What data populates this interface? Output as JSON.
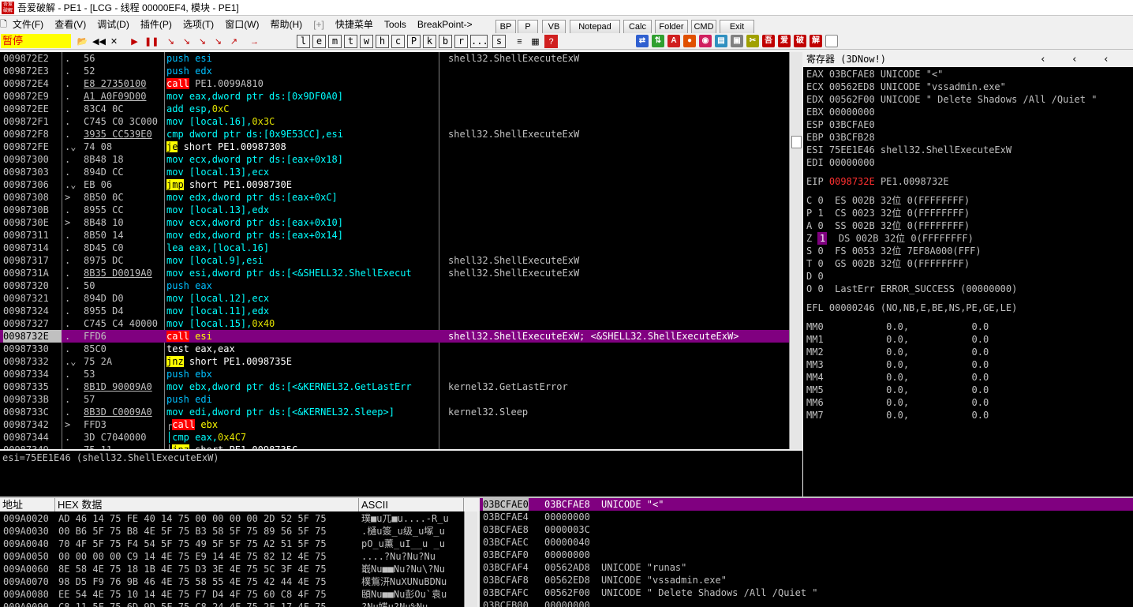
{
  "window": {
    "title": "吾爱破解 - PE1 - [LCG - 线程 00000EF4, 模块 - PE1]",
    "logo_text": "吾爱破解"
  },
  "menu": [
    "文件(F)",
    "查看(V)",
    "调试(D)",
    "插件(P)",
    "选项(T)",
    "窗口(W)",
    "帮助(H)",
    "[+]",
    "快捷菜单",
    "Tools",
    "BreakPoint->"
  ],
  "cmd_buttons": [
    "BP",
    "P",
    "VB",
    "Notepad",
    "Calc",
    "Folder",
    "CMD",
    "Exit"
  ],
  "toolbar": {
    "status": "暂停",
    "nav": [
      "◀◀",
      "✕",
      "▶",
      "❚❚",
      "↘",
      "↘",
      "↘",
      "↘",
      "↗",
      "→"
    ],
    "letters": [
      "l",
      "e",
      "m",
      "t",
      "w",
      "h",
      "c",
      "P",
      "k",
      "b",
      "r",
      "...",
      "s"
    ],
    "extra": [
      "≡",
      "▦",
      "?"
    ],
    "icons": [
      {
        "t": "⇄",
        "c": "#3060d0"
      },
      {
        "t": "⇅",
        "c": "#30a030"
      },
      {
        "t": "A",
        "c": "#d02020"
      },
      {
        "t": "●",
        "c": "#e05000"
      },
      {
        "t": "◉",
        "c": "#d02060"
      },
      {
        "t": "▤",
        "c": "#3090c0"
      },
      {
        "t": "▣",
        "c": "#808080"
      },
      {
        "t": "✂",
        "c": "#a0a000"
      },
      {
        "t": "吾",
        "c": "#c00000"
      },
      {
        "t": "爱",
        "c": "#c00000"
      },
      {
        "t": "破",
        "c": "#c00000"
      },
      {
        "t": "解",
        "c": "#c00000"
      },
      {
        "t": "",
        "c": "#ffffff"
      }
    ]
  },
  "disasm": [
    {
      "addr": "009872E2",
      "mark": ".",
      "hex": "56",
      "asm": [
        {
          "t": "push esi",
          "c": "#00c0ff"
        }
      ],
      "cmt": "shell32.ShellExecuteExW"
    },
    {
      "addr": "009872E3",
      "mark": ".",
      "hex": "52",
      "asm": [
        {
          "t": "push edx",
          "c": "#00c0ff"
        }
      ],
      "cmt": ""
    },
    {
      "addr": "009872E4",
      "mark": ".",
      "hex": "E8 27350100",
      "asm": [
        {
          "t": "call",
          "cls": "hl-call"
        },
        {
          "t": " PE1.0099A810",
          "c": "#c0c0c0"
        }
      ],
      "cmt": ""
    },
    {
      "addr": "009872E9",
      "mark": ".",
      "hex": "A1 A0F09D00",
      "asm": [
        {
          "t": "mov eax,dword ptr ds:[0x9DF0A0]",
          "c": "#00ffff"
        }
      ],
      "cmt": ""
    },
    {
      "addr": "009872EE",
      "mark": ".",
      "hex": "83C4 0C",
      "asm": [
        {
          "t": "add esp,",
          "c": "#00ffff"
        },
        {
          "t": "0xC",
          "c": "#e0e000"
        }
      ],
      "cmt": ""
    },
    {
      "addr": "009872F1",
      "mark": ".",
      "hex": "C745 C0 3C000",
      "asm": [
        {
          "t": "mov [local.16],",
          "c": "#00ffff"
        },
        {
          "t": "0x3C",
          "c": "#e0e000"
        }
      ],
      "cmt": ""
    },
    {
      "addr": "009872F8",
      "mark": ".",
      "hex": "3935 CC539E0",
      "asm": [
        {
          "t": "cmp dword ptr ds:[0x9E53CC],esi",
          "c": "#00ffff"
        }
      ],
      "cmt": "shell32.ShellExecuteExW"
    },
    {
      "addr": "009872FE",
      "mark": ".⌄",
      "hex": "74 08",
      "asm": [
        {
          "t": "je",
          "cls": "hl-jmp"
        },
        {
          "t": " short PE1.00987308",
          "c": "#ffffff"
        }
      ],
      "cmt": ""
    },
    {
      "addr": "00987300",
      "mark": ".",
      "hex": "8B48 18",
      "asm": [
        {
          "t": "mov ecx,dword ptr ds:[eax+0x18]",
          "c": "#00ffff"
        }
      ],
      "cmt": ""
    },
    {
      "addr": "00987303",
      "mark": ".",
      "hex": "894D CC",
      "asm": [
        {
          "t": "mov [local.13],ecx",
          "c": "#00ffff"
        }
      ],
      "cmt": ""
    },
    {
      "addr": "00987306",
      "mark": ".⌄",
      "hex": "EB 06",
      "asm": [
        {
          "t": "jmp",
          "cls": "hl-jmp"
        },
        {
          "t": " short PE1.0098730E",
          "c": "#ffffff"
        }
      ],
      "cmt": ""
    },
    {
      "addr": "00987308",
      "mark": ">",
      "hex": "8B50 0C",
      "asm": [
        {
          "t": "mov edx,dword ptr ds:[eax+0xC]",
          "c": "#00ffff"
        }
      ],
      "cmt": ""
    },
    {
      "addr": "0098730B",
      "mark": ".",
      "hex": "8955 CC",
      "asm": [
        {
          "t": "mov [local.13],edx",
          "c": "#00ffff"
        }
      ],
      "cmt": ""
    },
    {
      "addr": "0098730E",
      "mark": ">",
      "hex": "8B48 10",
      "asm": [
        {
          "t": "mov ecx,dword ptr ds:[eax+0x10]",
          "c": "#00ffff"
        }
      ],
      "cmt": ""
    },
    {
      "addr": "00987311",
      "mark": ".",
      "hex": "8B50 14",
      "asm": [
        {
          "t": "mov edx,dword ptr ds:[eax+0x14]",
          "c": "#00ffff"
        }
      ],
      "cmt": ""
    },
    {
      "addr": "00987314",
      "mark": ".",
      "hex": "8D45 C0",
      "asm": [
        {
          "t": "lea eax,[local.16]",
          "c": "#00ffff"
        }
      ],
      "cmt": ""
    },
    {
      "addr": "00987317",
      "mark": ".",
      "hex": "8975 DC",
      "asm": [
        {
          "t": "mov [local.9],esi",
          "c": "#00ffff"
        }
      ],
      "cmt": "shell32.ShellExecuteExW"
    },
    {
      "addr": "0098731A",
      "mark": ".",
      "hex": "8B35 D0019A0",
      "asm": [
        {
          "t": "mov esi,dword ptr ds:[<&SHELL32.ShellExecut",
          "c": "#00ffff"
        }
      ],
      "cmt": "shell32.ShellExecuteExW"
    },
    {
      "addr": "00987320",
      "mark": ".",
      "hex": "50",
      "asm": [
        {
          "t": "push eax",
          "c": "#00c0ff"
        }
      ],
      "cmt": ""
    },
    {
      "addr": "00987321",
      "mark": ".",
      "hex": "894D D0",
      "asm": [
        {
          "t": "mov [local.12],ecx",
          "c": "#00ffff"
        }
      ],
      "cmt": ""
    },
    {
      "addr": "00987324",
      "mark": ".",
      "hex": "8955 D4",
      "asm": [
        {
          "t": "mov [local.11],edx",
          "c": "#00ffff"
        }
      ],
      "cmt": ""
    },
    {
      "addr": "00987327",
      "mark": ".",
      "hex": "C745 C4 40000",
      "asm": [
        {
          "t": "mov [local.15],",
          "c": "#00ffff"
        },
        {
          "t": "0x40",
          "c": "#e0e000"
        }
      ],
      "cmt": ""
    },
    {
      "addr": "0098732E",
      "mark": ".",
      "hex": "FFD6",
      "sel": true,
      "asm": [
        {
          "t": "call",
          "cls": "hl-call"
        },
        {
          "t": " esi",
          "c": "#ffff00"
        }
      ],
      "cmt": "shell32.ShellExecuteExW; <&SHELL32.ShellExecuteExW>"
    },
    {
      "addr": "00987330",
      "mark": ".",
      "hex": "85C0",
      "asm": [
        {
          "t": "test eax,eax",
          "c": "#ffffff"
        }
      ],
      "cmt": ""
    },
    {
      "addr": "00987332",
      "mark": ".⌄",
      "hex": "75 2A",
      "asm": [
        {
          "t": "jnz",
          "cls": "hl-jmp"
        },
        {
          "t": " short PE1.0098735E",
          "c": "#ffffff"
        }
      ],
      "cmt": ""
    },
    {
      "addr": "00987334",
      "mark": ".",
      "hex": "53",
      "asm": [
        {
          "t": "push ebx",
          "c": "#00c0ff"
        }
      ],
      "cmt": ""
    },
    {
      "addr": "00987335",
      "mark": ".",
      "hex": "8B1D 90009A0",
      "asm": [
        {
          "t": "mov ebx,dword ptr ds:[<&KERNEL32.GetLastErr",
          "c": "#00ffff"
        }
      ],
      "cmt": "kernel32.GetLastError"
    },
    {
      "addr": "0098733B",
      "mark": ".",
      "hex": "57",
      "asm": [
        {
          "t": "push edi",
          "c": "#00c0ff"
        }
      ],
      "cmt": ""
    },
    {
      "addr": "0098733C",
      "mark": ".",
      "hex": "8B3D C0009A0",
      "asm": [
        {
          "t": "mov edi,dword ptr ds:[<&KERNEL32.Sleep>]",
          "c": "#00ffff"
        }
      ],
      "cmt": "kernel32.Sleep"
    },
    {
      "addr": "00987342",
      "mark": ">",
      "hex": "FFD3",
      "asm": [
        {
          "t": "┌",
          "c": "#c0c0c0"
        },
        {
          "t": "call",
          "cls": "hl-call"
        },
        {
          "t": " ebx",
          "c": "#ffff00"
        }
      ],
      "cmt": ""
    },
    {
      "addr": "00987344",
      "mark": ".",
      "hex": "3D C7040000",
      "asm": [
        {
          "t": "│cmp eax,",
          "c": "#00ffff"
        },
        {
          "t": "0x4C7",
          "c": "#e0e000"
        }
      ],
      "cmt": ""
    },
    {
      "addr": "00987349",
      "mark": ".",
      "hex": "75 11",
      "asm": [
        {
          "t": "│",
          "c": "#c0c0c0"
        },
        {
          "t": "jnz",
          "cls": "hl-jmp"
        },
        {
          "t": " short PE1.0098735C",
          "c": "#ffffff"
        }
      ],
      "cmt": ""
    }
  ],
  "info_line": "esi=75EE1E46 (shell32.ShellExecuteExW)",
  "registers": {
    "header": "寄存器 (3DNow!)",
    "lines": [
      "EAX 03BCFAE8 UNICODE \"<\"",
      "ECX 00562ED8 UNICODE \"vssadmin.exe\"",
      "EDX 00562F00 UNICODE \" Delete Shadows /All /Quiet \"",
      "EBX 00000000",
      "ESP 03BCFAE0",
      "EBP 03BCFB28",
      "ESI 75EE1E46 shell32.ShellExecuteExW",
      "EDI 00000000"
    ],
    "eip_label": "EIP",
    "eip_value": "0098732E",
    "eip_cmt": "PE1.0098732E",
    "flags": [
      {
        "f": "C",
        "v": "0",
        "rest": "  ES 002B 32位 0(FFFFFFFF)"
      },
      {
        "f": "P",
        "v": "1",
        "rest": "  CS 0023 32位 0(FFFFFFFF)"
      },
      {
        "f": "A",
        "v": "0",
        "rest": "  SS 002B 32位 0(FFFFFFFF)"
      },
      {
        "f": "Z",
        "v": "1",
        "boxed": true,
        "rest": "  DS 002B 32位 0(FFFFFFFF)"
      },
      {
        "f": "S",
        "v": "0",
        "rest": "  FS 0053 32位 7EF8A000(FFF)"
      },
      {
        "f": "T",
        "v": "0",
        "rest": "  GS 002B 32位 0(FFFFFFFF)"
      },
      {
        "f": "D",
        "v": "0",
        "rest": ""
      },
      {
        "f": "O",
        "v": "0",
        "rest": "  LastErr ERROR_SUCCESS (00000000)"
      }
    ],
    "efl": "EFL 00000246 (NO,NB,E,BE,NS,PE,GE,LE)",
    "mm": [
      "MM0           0.0,           0.0",
      "MM1           0.0,           0.0",
      "MM2           0.0,           0.0",
      "MM3           0.0,           0.0",
      "MM4           0.0,           0.0",
      "MM5           0.0,           0.0",
      "MM6           0.0,           0.0",
      "MM7           0.0,           0.0"
    ]
  },
  "dump": {
    "headers": [
      "地址",
      "HEX 数据",
      "ASCII"
    ],
    "rows": [
      {
        "addr": "009A0020",
        "hex": "AD 46 14 75 FE 40 14 75 00 00 00 00 2D 52 5F 75",
        "ascii": "璞■u兀■u....-R_u"
      },
      {
        "addr": "009A0030",
        "hex": "00 B6 5F 75 B8 4E 5F 75 B3 58 5F 75 89 56 5F 75",
        "ascii": ".樋u簽_u级_u塚_u"
      },
      {
        "addr": "009A0040",
        "hex": "70 4F 5F 75 F4 54 5F 75 49 5F 5F 75 A2 51 5F 75",
        "ascii": "pO_u薰_uI__u _u"
      },
      {
        "addr": "009A0050",
        "hex": "00 00 00 00 C9 14 4E 75 E9 14 4E 75 82 12 4E 75",
        "ascii": "....?Nu?Nu?Nu"
      },
      {
        "addr": "009A0060",
        "hex": "8E 58 4E 75 18 1B 4E 75 D3 3E 4E 75 5C 3F 4E 75",
        "ascii": "嶯Nu■■Nu?Nu\\?Nu"
      },
      {
        "addr": "009A0070",
        "hex": "98 D5 F9 76 9B 46 4E 75 58 55 4E 75 42 44 4E 75",
        "ascii": "樸鴜汧NuXUNuBDNu"
      },
      {
        "addr": "009A0080",
        "hex": "EE 54 4E 75 10 14 4E 75 F7 D4 4F 75 60 C8 4F 75",
        "ascii": "頣Nu■■Nu彭Ou`袁u"
      },
      {
        "addr": "009A0090",
        "hex": "C8 11 5F 75 6D 9D 5F 75 C8 24 4F 75 2F 17 4F 75",
        "ascii": "?Nu媟u?Nu%Nu"
      }
    ]
  },
  "stack": [
    {
      "addr": "03BCFAE0",
      "val": "03BCFAE8",
      "cmt": "UNICODE \"<\"",
      "sel": true
    },
    {
      "addr": "03BCFAE4",
      "val": "00000000",
      "cmt": ""
    },
    {
      "addr": "03BCFAE8",
      "val": "0000003C",
      "cmt": ""
    },
    {
      "addr": "03BCFAEC",
      "val": "00000040",
      "cmt": ""
    },
    {
      "addr": "03BCFAF0",
      "val": "00000000",
      "cmt": ""
    },
    {
      "addr": "03BCFAF4",
      "val": "00562AD8",
      "cmt": "UNICODE \"runas\""
    },
    {
      "addr": "03BCFAF8",
      "val": "00562ED8",
      "cmt": "UNICODE \"vssadmin.exe\""
    },
    {
      "addr": "03BCFAFC",
      "val": "00562F00",
      "cmt": "UNICODE \" Delete Shadows /All /Quiet \""
    },
    {
      "addr": "03BCFB00",
      "val": "00000000",
      "cmt": ""
    }
  ]
}
